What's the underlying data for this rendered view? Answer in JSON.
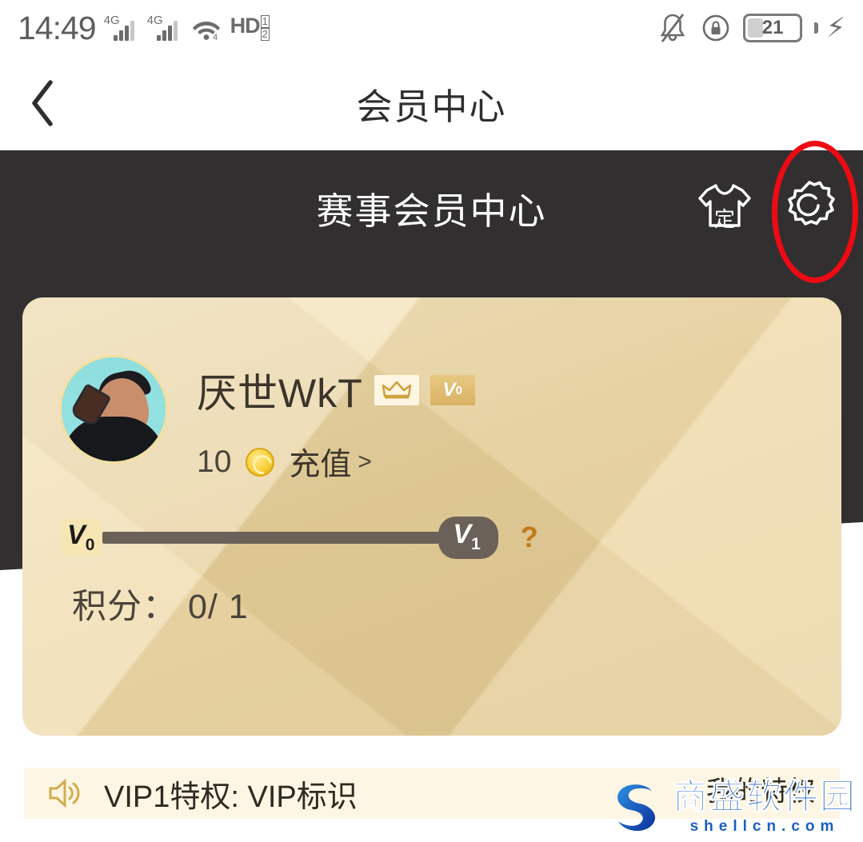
{
  "status_bar": {
    "time": "14:49",
    "network_1": "4G",
    "network_2": "4G",
    "wifi_icon": "wifi-icon",
    "hd_label": "HD",
    "hd_slot_1": "1",
    "hd_slot_2": "2",
    "bell_icon": "bell-muted-icon",
    "rotation_icon": "rotation-lock-icon",
    "battery_level": "21",
    "charging_icon": "charging-bolt-icon"
  },
  "nav": {
    "back_icon": "chevron-left-icon",
    "title": "会员中心"
  },
  "header": {
    "title": "赛事会员中心",
    "tshirt_icon": "tshirt-custom-icon",
    "tshirt_char": "定",
    "gear_icon": "gear-icon",
    "annotation": "red-ellipse-highlight"
  },
  "card": {
    "avatar_name": "user-avatar",
    "user_name": "厌世WkT",
    "crown_badge": "crown-icon",
    "vip_badge_text": "V",
    "vip_badge_level": "0",
    "coin_count": "10",
    "coin_icon": "gold-coin-icon",
    "recharge_label": "充值",
    "recharge_chevron": ">",
    "progress": {
      "start_label": "V",
      "start_level": "0",
      "end_label": "V",
      "end_level": "1",
      "percent": 0,
      "help_icon": "question-mark-icon"
    },
    "points_label": "积分：",
    "points_value": "0/ 1"
  },
  "privilege": {
    "speaker_icon": "speaker-icon",
    "text": "VIP1特权: VIP标识",
    "my_privilege_label": "我的特权"
  },
  "watermark": {
    "logo_icon": "shellcn-s-logo",
    "title": "商盛软件园",
    "subtitle": "shellcn.com"
  },
  "colors": {
    "dark_header": "#322f31",
    "card_gold": "#ecd49c",
    "annotation_red": "#ee0a13",
    "privilege_bg": "#fdf6e4",
    "watermark_blue": "#1a5fbf"
  }
}
